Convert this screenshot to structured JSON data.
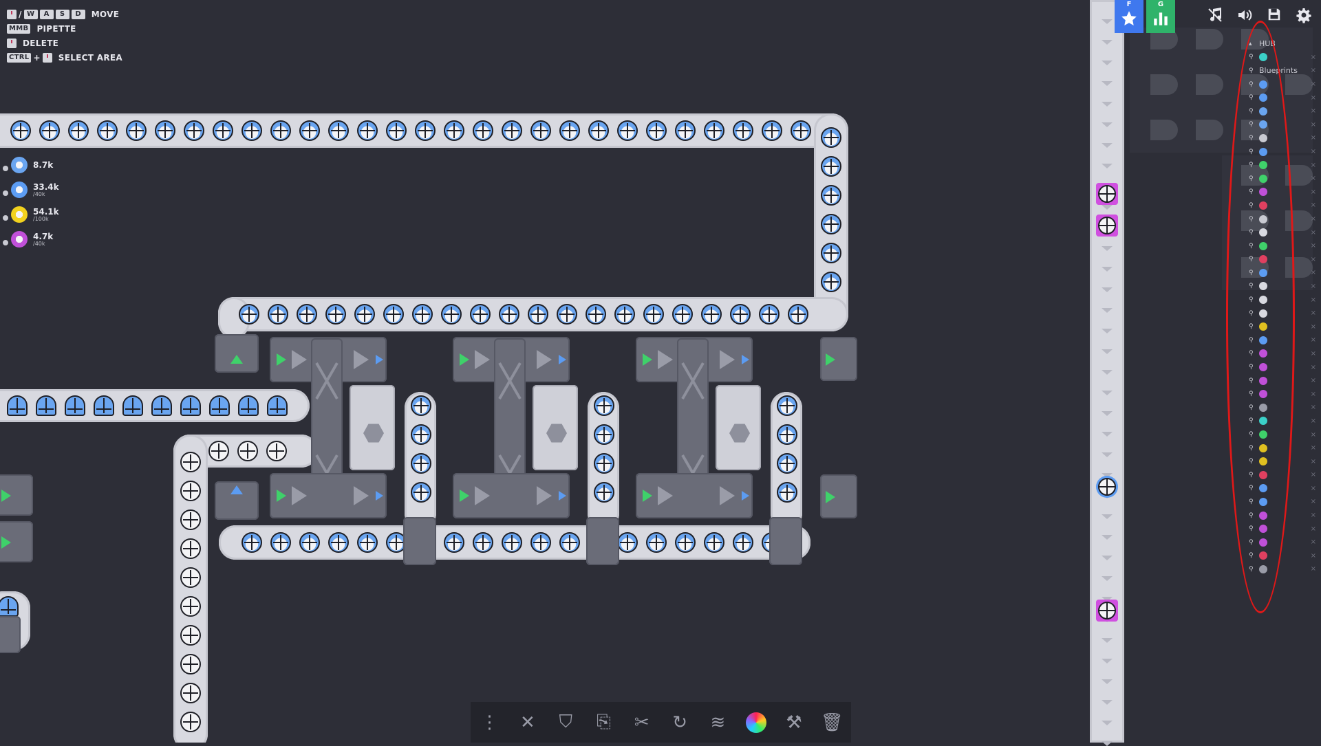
{
  "hints": [
    {
      "keys": [
        "W",
        "A",
        "S",
        "D"
      ],
      "mouse": true,
      "label": "MOVE"
    },
    {
      "keys": [
        "MMB"
      ],
      "mouse": false,
      "label": "PIPETTE"
    },
    {
      "keys": [],
      "mouse": true,
      "label": "DELETE"
    },
    {
      "keys": [
        "CTRL"
      ],
      "mouse": true,
      "label": "SELECT AREA"
    }
  ],
  "resources": [
    {
      "value": "8.7k",
      "cap": "",
      "color": "#6aa5f0"
    },
    {
      "value": "33.4k",
      "cap": "/40k",
      "color": "#5c9cf2"
    },
    {
      "value": "54.1k",
      "cap": "/100k",
      "color": "#f2d21e"
    },
    {
      "value": "4.7k",
      "cap": "/40k",
      "color": "#c050d8"
    }
  ],
  "top_buttons": {
    "favorites": {
      "badge": "F",
      "icon": "star-icon",
      "color": "#3f78ee"
    },
    "stats": {
      "badge": "G",
      "icon": "bar-chart-icon",
      "color": "#2fb36a"
    }
  },
  "icons": {
    "music": "music-icon",
    "sound": "speaker-icon",
    "save": "save-icon",
    "settings": "gear-icon"
  },
  "pinned": {
    "hub_label": "HUB",
    "blueprints_label": "Blueprints",
    "shape_colors": [
      "#3bd0c8",
      "#5c9cf2",
      "#5c9cf2",
      "#6aa5f0",
      "#6aa5f0",
      "#c9cad2",
      "#5c9cf2",
      "#3fd16a",
      "#3fd16a",
      "#c050d8",
      "#e04060",
      "#c9cad2",
      "#d8d9e0",
      "#3fd16a",
      "#e04060",
      "#5c9cf2",
      "#d8d9e0",
      "#d8d9e0",
      "#d8d9e0",
      "#e0c020",
      "#5c9cf2",
      "#c050d8",
      "#c050d8",
      "#c050d8",
      "#c050d8",
      "#9a9ca8",
      "#3bd0c8",
      "#3fd16a",
      "#e0c020",
      "#e0c020",
      "#e04060",
      "#5c9cf2",
      "#5c9cf2",
      "#c050d8",
      "#c050d8",
      "#c050d8",
      "#e04060",
      "#9a9ca8"
    ]
  },
  "toolbar": [
    {
      "name": "belt-tool-icon",
      "glyph": "⋮"
    },
    {
      "name": "split-tool-icon",
      "glyph": "✕"
    },
    {
      "name": "tunnel-tool-icon",
      "glyph": "⛉"
    },
    {
      "name": "clipboard-icon",
      "glyph": "⎘"
    },
    {
      "name": "cut-icon",
      "glyph": "✂"
    },
    {
      "name": "rotate-icon",
      "glyph": "↻"
    },
    {
      "name": "layers-icon",
      "glyph": "≋"
    },
    {
      "name": "color-wheel-icon",
      "glyph": "◉"
    },
    {
      "name": "paint-icon",
      "glyph": "⚒"
    },
    {
      "name": "trash-icon",
      "glyph": "🗑"
    }
  ]
}
